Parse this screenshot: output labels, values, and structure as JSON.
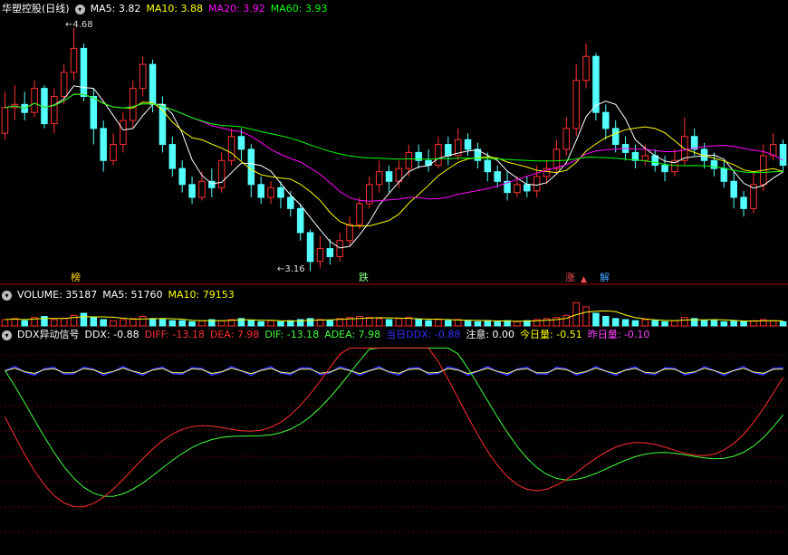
{
  "main_panel": {
    "title": "华塑控股(日线)",
    "ma_labels": [
      {
        "label": "MA5:",
        "value": "3.82",
        "color": "#ffffff"
      },
      {
        "label": "MA10:",
        "value": "3.88",
        "color": "#ffff00"
      },
      {
        "label": "MA20:",
        "value": "3.92",
        "color": "#ff00ff"
      },
      {
        "label": "MA60:",
        "value": "3.93",
        "color": "#00ff00"
      }
    ],
    "high_mark": "4.68",
    "low_mark": "3.16",
    "event_tags": [
      {
        "text": "榜",
        "color": "#ffd700"
      },
      {
        "text": "跌",
        "color": "#80ff80"
      },
      {
        "text": "涨",
        "color": "#ff5050"
      },
      {
        "text": "解",
        "color": "#40a0ff"
      }
    ]
  },
  "volume_panel": {
    "labels": [
      {
        "label": "VOLUME:",
        "value": "35187",
        "color": "#ffffff"
      },
      {
        "label": "MA5:",
        "value": "51760",
        "color": "#ffffff"
      },
      {
        "label": "MA10:",
        "value": "79153",
        "color": "#ffff00"
      }
    ]
  },
  "ddx_panel": {
    "title": "DDX异动信号",
    "labels": [
      {
        "label": "DDX:",
        "value": "-0.88",
        "color": "#ffffff"
      },
      {
        "label": "DIFF:",
        "value": "-13.18",
        "color": "#ff3030"
      },
      {
        "label": "DEA:",
        "value": "7.98",
        "color": "#ff3030"
      },
      {
        "label": "DIF:",
        "value": "-13.18",
        "color": "#40ff40"
      },
      {
        "label": "ADEA:",
        "value": "7.98",
        "color": "#40ff40"
      },
      {
        "label": "当日DDX:",
        "value": "-0.88",
        "color": "#3030ff"
      },
      {
        "label": "注意:",
        "value": "0.00",
        "color": "#ffffff"
      },
      {
        "label": "今日量:",
        "value": "-0.51",
        "color": "#ffff00"
      },
      {
        "label": "昨日量:",
        "value": "-0.10",
        "color": "#ff40ff"
      }
    ]
  },
  "chart_data": {
    "type": "candlestick",
    "candles": [
      [
        4.02,
        4.18,
        4.28,
        3.98
      ],
      [
        4.18,
        4.2,
        4.32,
        4.1
      ],
      [
        4.2,
        4.15,
        4.28,
        4.1
      ],
      [
        4.15,
        4.3,
        4.35,
        4.12
      ],
      [
        4.3,
        4.08,
        4.32,
        4.05
      ],
      [
        4.08,
        4.25,
        4.3,
        4.02
      ],
      [
        4.25,
        4.4,
        4.45,
        4.2
      ],
      [
        4.4,
        4.55,
        4.68,
        4.35
      ],
      [
        4.55,
        4.25,
        4.58,
        4.22
      ],
      [
        4.25,
        4.05,
        4.3,
        3.95
      ],
      [
        4.05,
        3.85,
        4.1,
        3.78
      ],
      [
        3.85,
        3.95,
        4.02,
        3.82
      ],
      [
        3.95,
        4.1,
        4.15,
        3.9
      ],
      [
        4.1,
        4.3,
        4.35,
        4.05
      ],
      [
        4.3,
        4.45,
        4.5,
        4.25
      ],
      [
        4.45,
        4.2,
        4.48,
        4.15
      ],
      [
        4.2,
        3.95,
        4.25,
        3.9
      ],
      [
        3.95,
        3.8,
        4.0,
        3.75
      ],
      [
        3.8,
        3.7,
        3.85,
        3.65
      ],
      [
        3.7,
        3.62,
        3.75,
        3.58
      ],
      [
        3.62,
        3.72,
        3.78,
        3.6
      ],
      [
        3.72,
        3.68,
        3.8,
        3.62
      ],
      [
        3.68,
        3.85,
        3.9,
        3.65
      ],
      [
        3.85,
        4.0,
        4.05,
        3.82
      ],
      [
        4.0,
        3.92,
        4.05,
        3.85
      ],
      [
        3.92,
        3.7,
        3.95,
        3.62
      ],
      [
        3.7,
        3.62,
        3.75,
        3.58
      ],
      [
        3.62,
        3.68,
        3.72,
        3.58
      ],
      [
        3.68,
        3.62,
        3.72,
        3.55
      ],
      [
        3.62,
        3.55,
        3.66,
        3.5
      ],
      [
        3.55,
        3.4,
        3.58,
        3.35
      ],
      [
        3.4,
        3.22,
        3.42,
        3.16
      ],
      [
        3.22,
        3.3,
        3.38,
        3.18
      ],
      [
        3.3,
        3.25,
        3.36,
        3.2
      ],
      [
        3.25,
        3.35,
        3.4,
        3.22
      ],
      [
        3.35,
        3.45,
        3.5,
        3.32
      ],
      [
        3.45,
        3.58,
        3.62,
        3.42
      ],
      [
        3.58,
        3.7,
        3.75,
        3.55
      ],
      [
        3.7,
        3.78,
        3.85,
        3.65
      ],
      [
        3.78,
        3.72,
        3.82,
        3.65
      ],
      [
        3.72,
        3.8,
        3.85,
        3.68
      ],
      [
        3.8,
        3.9,
        3.95,
        3.75
      ],
      [
        3.9,
        3.85,
        3.95,
        3.8
      ],
      [
        3.85,
        3.82,
        3.92,
        3.78
      ],
      [
        3.82,
        3.95,
        4.0,
        3.8
      ],
      [
        3.95,
        3.88,
        4.0,
        3.82
      ],
      [
        3.88,
        3.98,
        4.05,
        3.85
      ],
      [
        3.98,
        3.92,
        4.02,
        3.88
      ],
      [
        3.92,
        3.85,
        3.96,
        3.8
      ],
      [
        3.85,
        3.78,
        3.9,
        3.72
      ],
      [
        3.78,
        3.72,
        3.82,
        3.68
      ],
      [
        3.72,
        3.65,
        3.78,
        3.6
      ],
      [
        3.65,
        3.7,
        3.75,
        3.62
      ],
      [
        3.7,
        3.66,
        3.75,
        3.62
      ],
      [
        3.66,
        3.75,
        3.82,
        3.62
      ],
      [
        3.75,
        3.8,
        3.85,
        3.7
      ],
      [
        3.8,
        3.92,
        3.98,
        3.78
      ],
      [
        3.92,
        4.05,
        4.12,
        3.88
      ],
      [
        4.05,
        4.35,
        4.45,
        4.0
      ],
      [
        4.35,
        4.5,
        4.58,
        4.3
      ],
      [
        4.5,
        4.15,
        4.52,
        4.1
      ],
      [
        4.15,
        4.05,
        4.2,
        3.98
      ],
      [
        4.05,
        3.95,
        4.1,
        3.9
      ],
      [
        3.95,
        3.9,
        4.0,
        3.85
      ],
      [
        3.9,
        3.85,
        3.95,
        3.8
      ],
      [
        3.85,
        3.88,
        3.95,
        3.82
      ],
      [
        3.88,
        3.82,
        3.92,
        3.78
      ],
      [
        3.82,
        3.78,
        3.88,
        3.72
      ],
      [
        3.78,
        3.85,
        3.92,
        3.75
      ],
      [
        3.85,
        4.0,
        4.12,
        3.82
      ],
      [
        4.0,
        3.92,
        4.05,
        3.88
      ],
      [
        3.92,
        3.85,
        3.96,
        3.8
      ],
      [
        3.85,
        3.8,
        3.9,
        3.75
      ],
      [
        3.8,
        3.72,
        3.85,
        3.68
      ],
      [
        3.72,
        3.62,
        3.78,
        3.55
      ],
      [
        3.62,
        3.55,
        3.66,
        3.5
      ],
      [
        3.55,
        3.7,
        3.78,
        3.52
      ],
      [
        3.7,
        3.88,
        3.95,
        3.66
      ],
      [
        3.88,
        3.95,
        4.02,
        3.85
      ],
      [
        3.95,
        3.82,
        3.98,
        3.78
      ]
    ],
    "volumes": [
      6,
      7,
      5,
      8,
      9,
      6,
      7,
      10,
      12,
      8,
      6,
      5,
      6,
      7,
      9,
      7,
      6,
      5,
      5,
      4,
      5,
      6,
      5,
      6,
      7,
      5,
      4,
      5,
      4,
      5,
      6,
      7,
      6,
      5,
      7,
      8,
      9,
      8,
      7,
      6,
      7,
      8,
      6,
      5,
      6,
      5,
      6,
      5,
      4,
      5,
      4,
      5,
      4,
      5,
      6,
      7,
      8,
      10,
      22,
      18,
      12,
      9,
      7,
      6,
      5,
      6,
      5,
      4,
      5,
      8,
      7,
      5,
      5,
      4,
      5,
      4,
      5,
      6,
      5,
      4
    ],
    "price_range": [
      3.1,
      4.75
    ],
    "volume_max": 24,
    "ddx_range": [
      -12,
      2
    ]
  }
}
